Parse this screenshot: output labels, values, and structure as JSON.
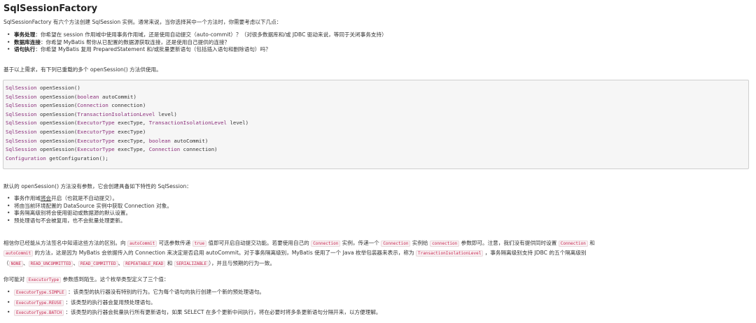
{
  "title": "SqlSessionFactory",
  "intro": "SqlSessionFactory 有六个方法创建 SqlSession 实例。通常来说，当你选择其中一个方法时，你需要考虑以下几点：",
  "considerations": [
    {
      "label": "事务处理",
      "text": "：你希望在 session 作用域中使用事务作用域，还是使用自动提交（auto-commit）？（对很多数据库和/或 JDBC 驱动来说，等同于关闭事务支持）"
    },
    {
      "label": "数据库连接",
      "text": "：你希望 MyBatis 帮你从已配置的数据源获取连接，还是使用自己提供的连接？"
    },
    {
      "label": "语句执行",
      "text": "：你希望 MyBatis 复用 PreparedStatement 和/或批量更新语句（包括插入语句和删除语句）吗？"
    }
  ],
  "overload_intro": "基于以上需求，有下列已重载的多个 openSession() 方法供使用。",
  "code": {
    "lines": [
      {
        "ret": "SqlSession",
        "name": " openSession(",
        "params": [],
        "close": ")"
      },
      {
        "ret": "SqlSession",
        "name": " openSession(",
        "params": [
          [
            "boolean",
            " autoCommit"
          ]
        ],
        "close": ")"
      },
      {
        "ret": "SqlSession",
        "name": " openSession(",
        "params": [
          [
            "Connection",
            " connection"
          ]
        ],
        "close": ")"
      },
      {
        "ret": "SqlSession",
        "name": " openSession(",
        "params": [
          [
            "TransactionIsolationLevel",
            " level"
          ]
        ],
        "close": ")"
      },
      {
        "ret": "SqlSession",
        "name": " openSession(",
        "params": [
          [
            "ExecutorType",
            " execType, "
          ],
          [
            "TransactionIsolationLevel",
            " level"
          ]
        ],
        "close": ")"
      },
      {
        "ret": "SqlSession",
        "name": " openSession(",
        "params": [
          [
            "ExecutorType",
            " execType"
          ]
        ],
        "close": ")"
      },
      {
        "ret": "SqlSession",
        "name": " openSession(",
        "params": [
          [
            "ExecutorType",
            " execType, "
          ],
          [
            "boolean",
            " autoCommit"
          ]
        ],
        "close": ")"
      },
      {
        "ret": "SqlSession",
        "name": " openSession(",
        "params": [
          [
            "ExecutorType",
            " execType, "
          ],
          [
            "Connection",
            " connection"
          ]
        ],
        "close": ")"
      },
      {
        "ret": "Configuration",
        "name": " getConfiguration(",
        "params": [],
        "close": ");"
      }
    ]
  },
  "defaults_intro": "默认的 openSession() 方法没有参数，它会创建具备如下特性的 SqlSession：",
  "defaults": [
    {
      "pre": "事务作用域",
      "u": "将会",
      "post": "开启（也就是不自动提交）。"
    },
    {
      "pre": "将由当前环境配置的 DataSource 实例中获取 Connection 对象。",
      "u": "",
      "post": ""
    },
    {
      "pre": "事务隔离级别将会使用驱动或数据源的默认设置。",
      "u": "",
      "post": ""
    },
    {
      "pre": "预处理语句不会被复用，也不会批量处理更新。",
      "u": "",
      "post": ""
    }
  ],
  "para": {
    "l1a": "相信你已经能从方法签名中知道这些方法的区别。向",
    "c1": "autoCommit",
    "l1b": "可选参数传递",
    "c2": "true",
    "l1c": "值即可开启自动提交功能。若要使用自己的",
    "c3": "Connection",
    "l1d": "实例，传递一个",
    "c4": "Connection",
    "l1e": "实例给",
    "c5": "connection",
    "l1f": "参数即可。注意，我们没有提供同时设置",
    "c6": "Connection",
    "l1g": "和",
    "c7": "autoCommit",
    "l2a": "的方法，这是因为 MyBatis 会依据传入的 Connection 来决定是否启用 autoCommit。对于事务隔离级别，MyBatis 使用了一个 Java 枚举包装器来表示，称为",
    "c8": "TransactionIsolationLevel",
    "l2b": "，事务隔离级别支持 JDBC 的五个隔离级别",
    "l3a": "（",
    "c9": "NONE",
    "s1": "、",
    "c10": "READ_UNCOMMITTED",
    "s2": "、",
    "c11": "READ_COMMITTED",
    "s3": "、",
    "c12": "REPEATABLE_READ",
    "s4": " 和 ",
    "c13": "SERIALIZABLE",
    "l3b": "），并且与预期的行为一致。"
  },
  "exec_intro_a": "你可能对",
  "exec_intro_code": "ExecutorType",
  "exec_intro_b": "参数感到陌生。这个枚举类型定义了三个值：",
  "executor_types": [
    {
      "code": "ExecutorType.SIMPLE",
      "text": "：该类型的执行器没有特别的行为。它为每个语句的执行创建一个新的预处理语句。"
    },
    {
      "code": "ExecutorType.REUSE",
      "text": "：该类型的执行器会复用预处理语句。"
    },
    {
      "code": "ExecutorType.BATCH",
      "text": "：该类型的执行器会批量执行所有更新语句，如果 SELECT 在多个更新中间执行，将在必要时将多条更新语句分隔开来，以方便理解。"
    }
  ]
}
